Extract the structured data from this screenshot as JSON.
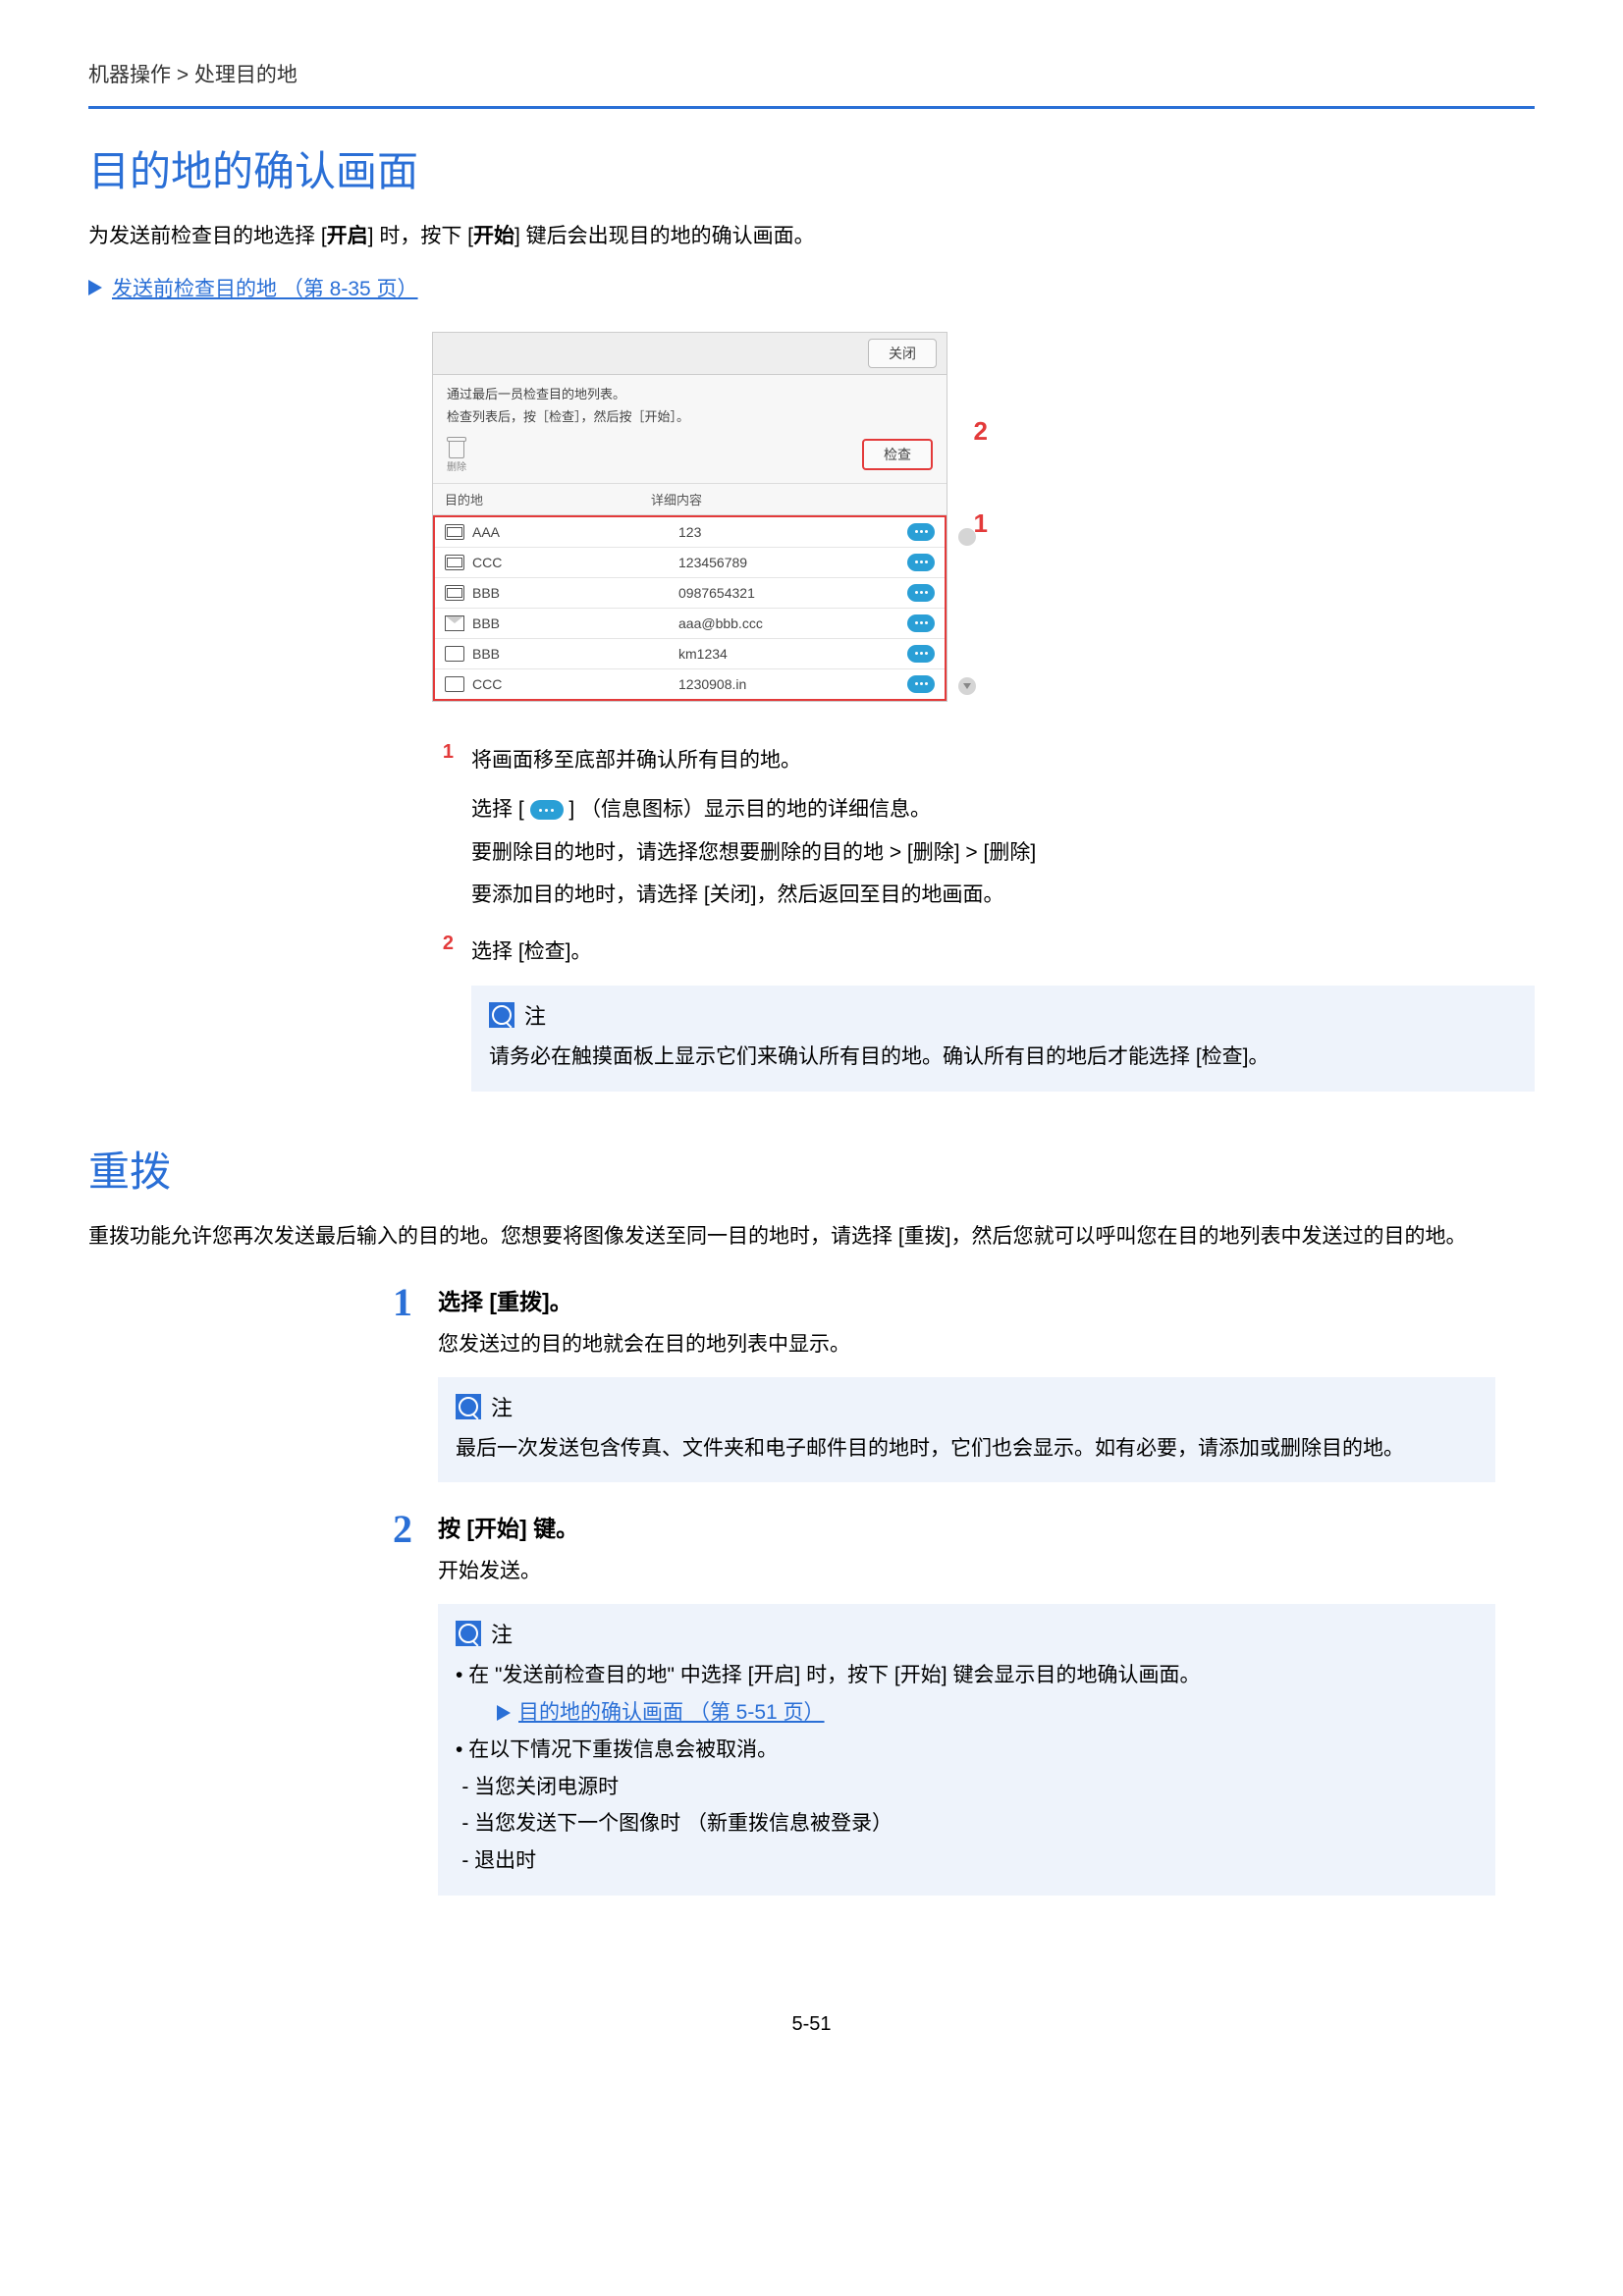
{
  "breadcrumb": "机器操作 > 处理目的地",
  "section1": {
    "title": "目的地的确认画面",
    "intro_pre": "为发送前检查目的地选择 [",
    "intro_k1": "开启",
    "intro_mid": "] 时，按下 [",
    "intro_k2": "开始",
    "intro_end": "] 键后会出现目的地的确认画面。",
    "xref": "发送前检查目的地 （第 8-35 页）",
    "callout1": "1",
    "callout2": "2"
  },
  "shot": {
    "close": "关闭",
    "msg1": "通过最后一员检查目的地列表。",
    "msg2": "检查列表后，按［检查］，然后按［开始］。",
    "trash_label": "删除",
    "check": "检查",
    "col_dest": "目的地",
    "col_detail": "详细内容",
    "rows": [
      {
        "icon": "fax",
        "name": "AAA",
        "detail": "123"
      },
      {
        "icon": "fax",
        "name": "CCC",
        "detail": "123456789"
      },
      {
        "icon": "fax",
        "name": "BBB",
        "detail": "0987654321"
      },
      {
        "icon": "mail",
        "name": "BBB",
        "detail": "aaa@bbb.ccc"
      },
      {
        "icon": "folder",
        "name": "BBB",
        "detail": "km1234"
      },
      {
        "icon": "folder",
        "name": "CCC",
        "detail": "1230908.in"
      }
    ]
  },
  "inst": {
    "n1": "1",
    "l1": "将画面移至底部并确认所有目的地。",
    "l1a_pre": "选择 [ ",
    "l1a_post": " ] （信息图标）显示目的地的详细信息。",
    "l1b": "要删除目的地时，请选择您想要删除的目的地 > [删除] > [删除]",
    "l1c": "要添加目的地时，请选择 [关闭]，然后返回至目的地画面。",
    "n2": "2",
    "l2": "选择 [检查]。",
    "note_label": "注",
    "note_text": "请务必在触摸面板上显示它们来确认所有目的地。确认所有目的地后才能选择 [检查]。"
  },
  "section2": {
    "title": "重拨",
    "intro": "重拨功能允许您再次发送最后输入的目的地。您想要将图像发送至同一目的地时，请选择 [重拨]，然后您就可以呼叫您在目的地列表中发送过的目的地。"
  },
  "steps": {
    "s1n": "1",
    "s1t": "选择 [重拨]。",
    "s1p": "您发送过的目的地就会在目的地列表中显示。",
    "note_label": "注",
    "s1note": "最后一次发送包含传真、文件夹和电子邮件目的地时，它们也会显示。如有必要，请添加或删除目的地。",
    "s2n": "2",
    "s2t": "按 [开始] 键。",
    "s2p": "开始发送。",
    "s2note_a": "在 \"发送前检查目的地\" 中选择 [开启] 时，按下 [开始] 键会显示目的地确认画面。",
    "s2note_link": "目的地的确认画面 （第 5-51 页）",
    "s2note_b": "在以下情况下重拨信息会被取消。",
    "s2note_b1": "当您关闭电源时",
    "s2note_b2": "当您发送下一个图像时 （新重拨信息被登录）",
    "s2note_b3": "退出时"
  },
  "page_num": "5-51"
}
